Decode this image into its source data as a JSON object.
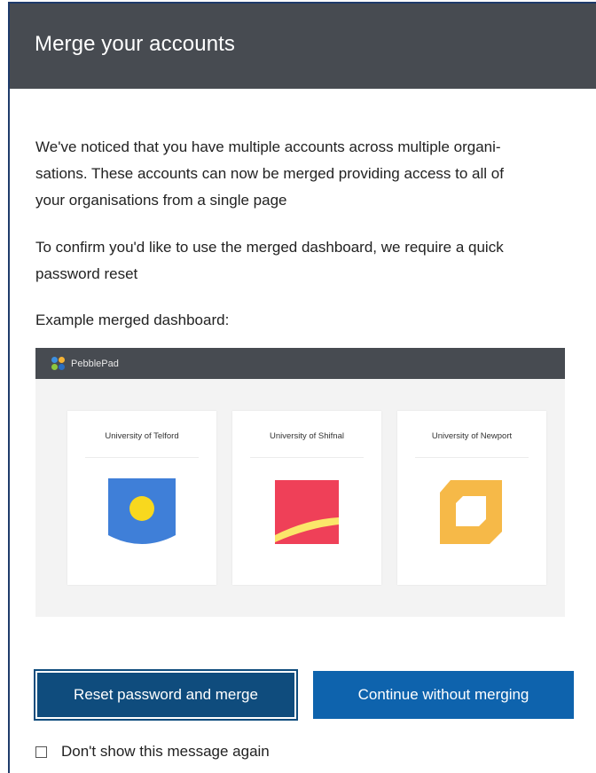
{
  "dialog": {
    "title": "Merge your accounts",
    "paragraph1_line1": "We've noticed that you have multiple accounts across multiple organi-",
    "paragraph1_line2": "sations. These accounts can now be merged providing access to all of",
    "paragraph1_line3": "your organisations from a single page",
    "paragraph2_line1": "To confirm you'd like to use the merged dashboard, we require a quick",
    "paragraph2_line2": "password reset",
    "example_label": "Example merged dashboard:"
  },
  "preview": {
    "app_name": "PebblePad",
    "cards": [
      {
        "name": "University of Telford"
      },
      {
        "name": "University of Shifnal"
      },
      {
        "name": "University of Newport"
      }
    ]
  },
  "actions": {
    "primary_label": "Reset password and merge",
    "secondary_label": "Continue without merging",
    "checkbox_label": "Don't show this message again",
    "checkbox_checked": false
  },
  "colors": {
    "header_bg": "#474b51",
    "primary_button": "#0f4c7d",
    "secondary_button": "#0e63ad",
    "telford_blue": "#3f7fd8",
    "telford_yellow": "#f8d81e",
    "shifnal_red": "#ef4058",
    "shifnal_yellow": "#fbe66a",
    "newport_orange": "#f6b948"
  }
}
